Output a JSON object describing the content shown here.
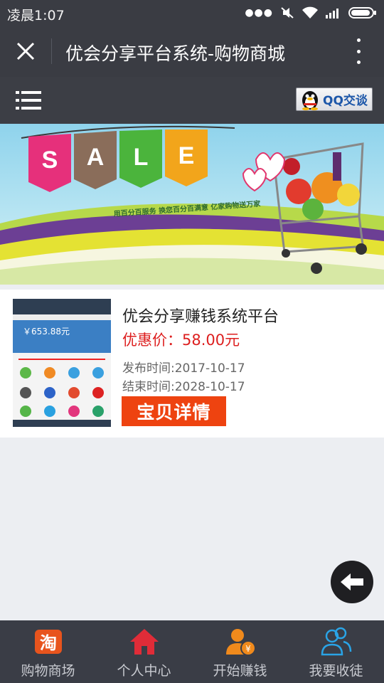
{
  "status_bar": {
    "time": "凌晨1:07"
  },
  "titlebar": {
    "title": "优会分享平台系统-购物商城"
  },
  "header": {
    "qq_label": "QQ交谈"
  },
  "banner": {
    "sale_letters": [
      "S",
      "A",
      "L",
      "E"
    ],
    "slogan": "用百分百服务 换您百分百满意 亿家购物送万家"
  },
  "product": {
    "title": "优会分享赚钱系统平台",
    "price": "优惠价：58.00元",
    "publish": "发布时间:2017-10-17",
    "end": "结束时间:2028-10-17",
    "detail_label": "宝贝详情",
    "thumb_amount": "￥653.88元"
  },
  "tabbar": {
    "items": [
      {
        "label": "购物商场",
        "icon": "taobao-icon"
      },
      {
        "label": "个人中心",
        "icon": "home-icon"
      },
      {
        "label": "开始赚钱",
        "icon": "person-yuan-icon"
      },
      {
        "label": "我要收徒",
        "icon": "users-icon"
      }
    ]
  },
  "colors": {
    "price_red": "#dd1f1f",
    "button_orange": "#ee4310",
    "bar_dark": "#3a3c43"
  }
}
